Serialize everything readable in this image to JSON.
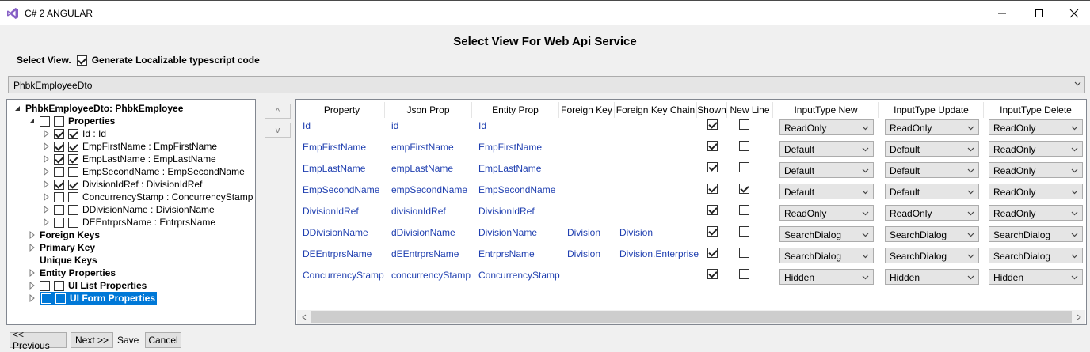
{
  "window": {
    "title": "C# 2 ANGULAR"
  },
  "heading": "Select View For Web Api Service",
  "select_view": {
    "label": "Select View.",
    "localizable_label": "Generate Localizable typescript code",
    "localizable_checked": true
  },
  "view_combo": {
    "selected": "PhbkEmployeeDto"
  },
  "tree": {
    "root": "PhbkEmployeeDto: PhbkEmployee",
    "properties_label": "Properties",
    "properties": [
      {
        "label": "Id : Id",
        "checked": true
      },
      {
        "label": "EmpFirstName : EmpFirstName",
        "checked": true
      },
      {
        "label": "EmpLastName : EmpLastName",
        "checked": true
      },
      {
        "label": "EmpSecondName : EmpSecondName",
        "checked": false
      },
      {
        "label": "DivisionIdRef : DivisionIdRef",
        "checked": true
      },
      {
        "label": "ConcurrencyStamp : ConcurrencyStamp",
        "checked": false
      },
      {
        "label": "DDivisionName : DivisionName",
        "checked": false
      },
      {
        "label": "DEEntrprsName : EntrprsName",
        "checked": false
      }
    ],
    "foreign_keys": "Foreign Keys",
    "primary_key": "Primary Key",
    "unique_keys": "Unique Keys",
    "entity_properties": "Entity Properties",
    "ui_list_properties": "UI List Properties",
    "ui_form_properties": "UI Form Properties"
  },
  "move_buttons": {
    "up": "^",
    "down": "v"
  },
  "grid": {
    "columns": [
      "Property",
      "Json Prop",
      "Entity Prop",
      "Foreign Key",
      "Foreign Key Chain",
      "Shown",
      "New Line",
      "InputType New",
      "InputType Update",
      "InputType Delete"
    ],
    "rows": [
      {
        "property": "Id",
        "json": "id",
        "entity": "Id",
        "fk": "",
        "fk_chain": "",
        "shown": true,
        "new_line": false,
        "input_new": "ReadOnly",
        "input_update": "ReadOnly",
        "input_delete": "ReadOnly"
      },
      {
        "property": "EmpFirstName",
        "json": "empFirstName",
        "entity": "EmpFirstName",
        "fk": "",
        "fk_chain": "",
        "shown": true,
        "new_line": false,
        "input_new": "Default",
        "input_update": "Default",
        "input_delete": "ReadOnly"
      },
      {
        "property": "EmpLastName",
        "json": "empLastName",
        "entity": "EmpLastName",
        "fk": "",
        "fk_chain": "",
        "shown": true,
        "new_line": false,
        "input_new": "Default",
        "input_update": "Default",
        "input_delete": "ReadOnly"
      },
      {
        "property": "EmpSecondName",
        "json": "empSecondName",
        "entity": "EmpSecondName",
        "fk": "",
        "fk_chain": "",
        "shown": true,
        "new_line": true,
        "input_new": "Default",
        "input_update": "Default",
        "input_delete": "ReadOnly"
      },
      {
        "property": "DivisionIdRef",
        "json": "divisionIdRef",
        "entity": "DivisionIdRef",
        "fk": "",
        "fk_chain": "",
        "shown": true,
        "new_line": false,
        "input_new": "ReadOnly",
        "input_update": "ReadOnly",
        "input_delete": "ReadOnly"
      },
      {
        "property": "DDivisionName",
        "json": "dDivisionName",
        "entity": "DivisionName",
        "fk": "Division",
        "fk_chain": "Division",
        "shown": true,
        "new_line": false,
        "input_new": "SearchDialog",
        "input_update": "SearchDialog",
        "input_delete": "SearchDialog"
      },
      {
        "property": "DEEntrprsName",
        "json": "dEEntrprsName",
        "entity": "EntrprsName",
        "fk": "Division",
        "fk_chain": "Division.Enterprise",
        "shown": true,
        "new_line": false,
        "input_new": "SearchDialog",
        "input_update": "SearchDialog",
        "input_delete": "SearchDialog"
      },
      {
        "property": "ConcurrencyStamp",
        "json": "concurrencyStamp",
        "entity": "ConcurrencyStamp",
        "fk": "",
        "fk_chain": "",
        "shown": true,
        "new_line": false,
        "input_new": "Hidden",
        "input_update": "Hidden",
        "input_delete": "Hidden"
      }
    ]
  },
  "buttons": {
    "previous": "<< Previous",
    "next": "Next >>",
    "save": "Save",
    "cancel": "Cancel"
  },
  "colors": {
    "accent": "#0078d7",
    "link_text": "#1f3fb0",
    "background": "#f0f0f0"
  }
}
